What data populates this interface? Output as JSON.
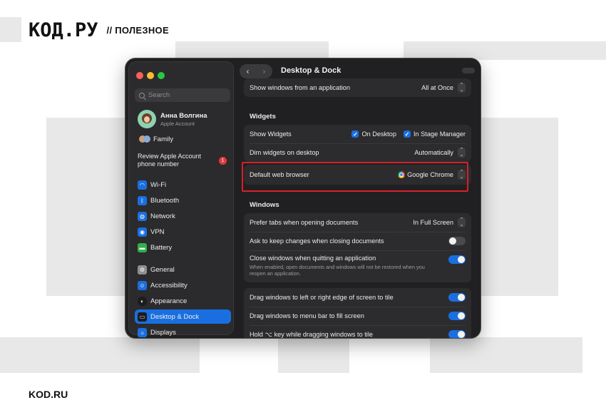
{
  "brand": {
    "logo": "КОД.РУ",
    "tagline": "// ПОЛЕЗНОЕ",
    "footer": "KOD.RU"
  },
  "colors": {
    "accent": "#1a6fe0",
    "highlight": "#d8202a",
    "badge": "#e23b3b"
  },
  "window": {
    "title": "Desktop & Dock"
  },
  "search": {
    "placeholder": "Search"
  },
  "account": {
    "name": "Анна Волгина",
    "subtitle": "Apple Account",
    "family": "Family"
  },
  "review": {
    "text": "Review Apple Account phone number",
    "badge": "1"
  },
  "sidebar": {
    "items": [
      {
        "label": "Wi-Fi",
        "icon": "wifi-icon",
        "color": "#1a6fe0"
      },
      {
        "label": "Bluetooth",
        "icon": "bluetooth-icon",
        "color": "#1a6fe0"
      },
      {
        "label": "Network",
        "icon": "globe-icon",
        "color": "#1a6fe0"
      },
      {
        "label": "VPN",
        "icon": "vpn-icon",
        "color": "#1a6fe0"
      },
      {
        "label": "Battery",
        "icon": "battery-icon",
        "color": "#30b04a"
      },
      {
        "label": "General",
        "icon": "gear-icon",
        "color": "#8e8e93"
      },
      {
        "label": "Accessibility",
        "icon": "accessibility-icon",
        "color": "#1a6fe0"
      },
      {
        "label": "Appearance",
        "icon": "appearance-icon",
        "color": "#1c1c1e"
      },
      {
        "label": "Desktop & Dock",
        "icon": "dock-icon",
        "color": "#1c1c1e"
      },
      {
        "label": "Displays",
        "icon": "display-icon",
        "color": "#1a6fe0"
      }
    ],
    "selected": "Desktop & Dock"
  },
  "settings": {
    "show_windows": {
      "label": "Show windows from an application",
      "value": "All at Once"
    },
    "widgets_header": "Widgets",
    "show_widgets": {
      "label": "Show Widgets",
      "on_desktop": "On Desktop",
      "in_stage_manager": "In Stage Manager"
    },
    "dim_widgets": {
      "label": "Dim widgets on desktop",
      "value": "Automatically"
    },
    "default_browser": {
      "label": "Default web browser",
      "value": "Google Chrome"
    },
    "windows_header": "Windows",
    "prefer_tabs": {
      "label": "Prefer tabs when opening documents",
      "value": "In Full Screen"
    },
    "ask_keep": {
      "label": "Ask to keep changes when closing documents"
    },
    "close_windows": {
      "label": "Close windows when quitting an application",
      "description": "When enabled, open documents and windows will not be restored when you reopen an application."
    },
    "drag_left_right": {
      "label": "Drag windows to left or right edge of screen to tile"
    },
    "drag_menubar": {
      "label": "Drag windows to menu bar to fill screen"
    },
    "hold_key": {
      "label": "Hold ⌥ key while dragging windows to tile"
    }
  }
}
